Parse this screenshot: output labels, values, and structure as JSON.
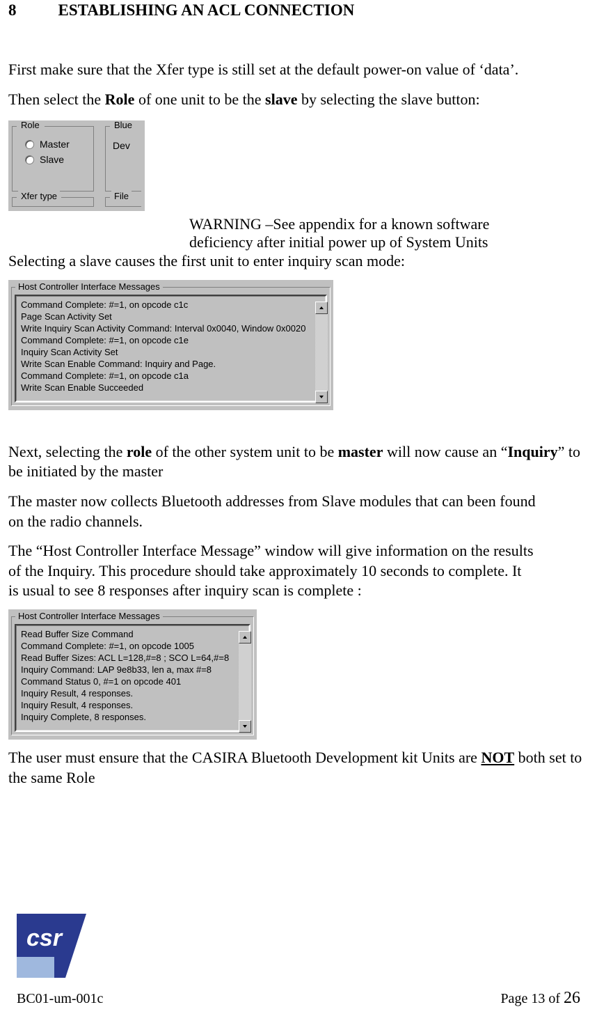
{
  "heading": {
    "number": "8",
    "title": "ESTABLISHING AN ACL CONNECTION"
  },
  "para1": "First make sure that the Xfer type is still set at the default power-on value of ‘data’.",
  "para2_pre": "Then select the ",
  "para2_role": "Role",
  "para2_mid": " of one unit to be the ",
  "para2_slave": "slave",
  "para2_post": " by selecting the slave button:",
  "role_fig": {
    "group_role": "Role",
    "opt_master": "Master",
    "opt_slave": "Slave",
    "group_xfer": "Xfer type",
    "right_top": "Blue",
    "right_dev": "Dev",
    "right_file": "File"
  },
  "warning_line1": "WARNING –See appendix for a known software",
  "warning_line2": "deficiency after initial power up of System Units",
  "para3": "Selecting a slave causes the first unit to enter inquiry scan mode:",
  "hci1": {
    "title": "Host Controller Interface Messages",
    "lines": [
      "Command Complete: #=1, on opcode c1c",
      "Page Scan Activity Set",
      "Write Inquiry Scan Activity Command: Interval 0x0040, Window 0x0020",
      "Command Complete: #=1, on opcode c1e",
      "Inquiry Scan Activity Set",
      "Write Scan Enable Command: Inquiry and Page.",
      "Command Complete: #=1, on opcode c1a",
      "Write Scan Enable Succeeded"
    ]
  },
  "para4_pre": "Next, selecting the ",
  "para4_role": "role",
  "para4_mid": " of the other system unit to be ",
  "para4_master": "master",
  "para4_mid2": " will now cause an “",
  "para4_inquiry": "Inquiry",
  "para4_post": "” to be initiated by the master",
  "para5a": "The master now collects Bluetooth addresses from Slave modules that can been found",
  "para5b": "on the radio channels.",
  "para6a": "The “Host Controller Interface Message” window will give information on the results",
  "para6b": "of the Inquiry. This procedure should take approximately 10 seconds to complete. It",
  "para6c": "is usual to see 8 responses after inquiry scan is complete :",
  "hci2": {
    "title": "Host Controller Interface Messages",
    "lines": [
      "Read Buffer Size Command",
      "Command Complete: #=1, on opcode 1005",
      "Read Buffer Sizes: ACL L=128,#=8 ; SCO L=64,#=8",
      "Inquiry Command: LAP 9e8b33, len a, max #=8",
      "Command Status 0, #=1 on opcode 401",
      "Inquiry Result, 4 responses.",
      "Inquiry Result, 4 responses.",
      "Inquiry Complete, 8 responses."
    ]
  },
  "para7_pre": "The user must ensure that the CASIRA Bluetooth Development kit Units are ",
  "para7_not": "NOT",
  "para7_post": " both set to the same Role",
  "footer": {
    "doc": "BC01-um-001c",
    "page_label": "Page ",
    "page_num": "13",
    "of_label": " of ",
    "total": "26"
  }
}
